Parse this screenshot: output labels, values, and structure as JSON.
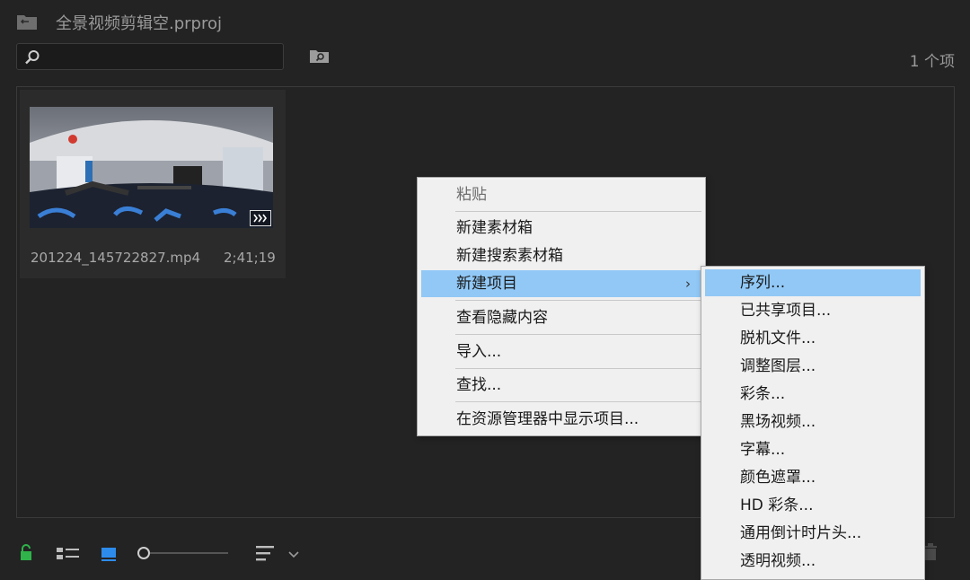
{
  "header": {
    "title": "全景视频剪辑空.prproj",
    "item_count": "1 个项",
    "search_value": ""
  },
  "clip": {
    "name": "201224_145722827.mp4",
    "duration": "2;41;19"
  },
  "context_menu": {
    "items": [
      {
        "label": "粘贴",
        "state": "disabled"
      },
      {
        "label": "新建素材箱"
      },
      {
        "label": "新建搜索素材箱"
      },
      {
        "label": "新建项目",
        "submenu": true,
        "state": "highlighted"
      },
      {
        "label": "查看隐藏内容"
      },
      {
        "label": "导入..."
      },
      {
        "label": "查找..."
      },
      {
        "label": "在资源管理器中显示项目..."
      }
    ],
    "submenu_arrow": "›"
  },
  "submenu": {
    "items": [
      {
        "label": "序列...",
        "state": "highlighted"
      },
      {
        "label": "已共享项目..."
      },
      {
        "label": "脱机文件..."
      },
      {
        "label": "调整图层..."
      },
      {
        "label": "彩条..."
      },
      {
        "label": "黑场视频..."
      },
      {
        "label": "字幕..."
      },
      {
        "label": "颜色遮罩..."
      },
      {
        "label": "HD 彩条..."
      },
      {
        "label": "通用倒计时片头..."
      },
      {
        "label": "透明视频..."
      }
    ]
  },
  "colors": {
    "menu_highlight": "#91c8f6",
    "lock_green": "#2fb34a",
    "icon_view_blue": "#2d8ceb"
  }
}
